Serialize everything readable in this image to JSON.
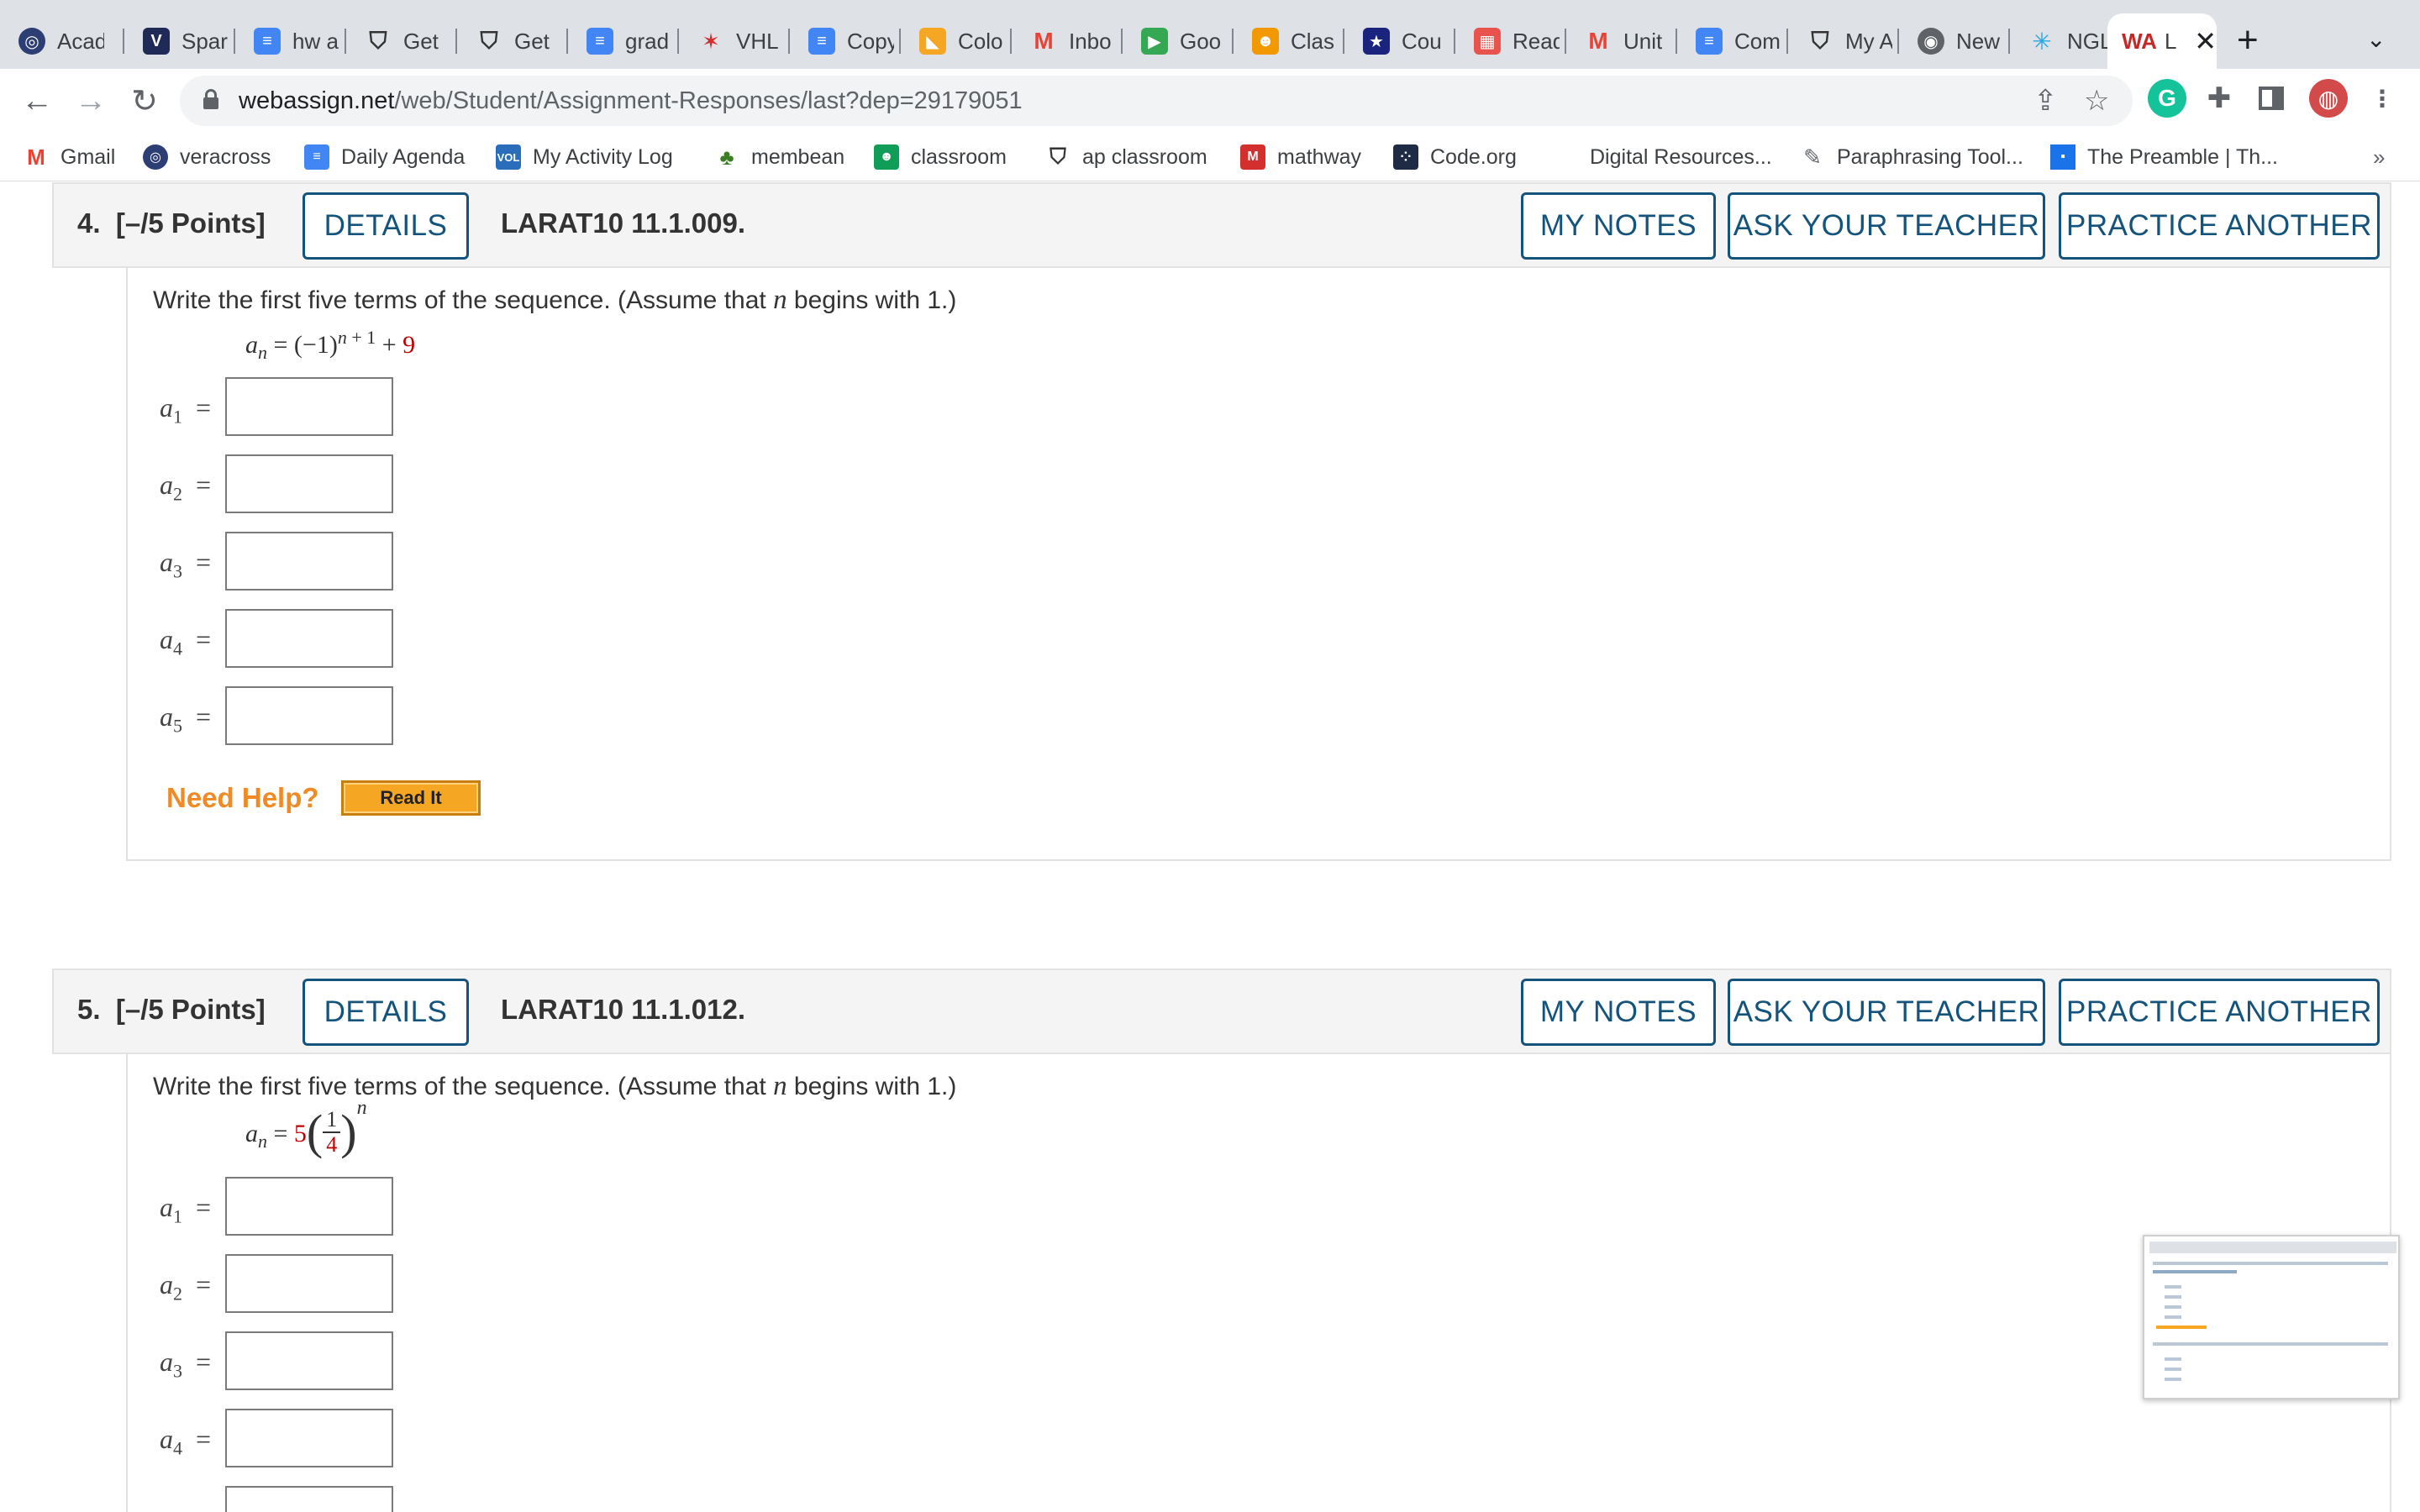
{
  "tabs": [
    {
      "title": "Acad",
      "icon": "circle-logo-icon",
      "color": "#2c3e73"
    },
    {
      "title": "Spar",
      "icon": "v-logo-icon",
      "color": "#1f2a57"
    },
    {
      "title": "hw a",
      "icon": "docs-icon",
      "color": "#4285f4"
    },
    {
      "title": "Get",
      "icon": "acorn-icon",
      "color": "#333333"
    },
    {
      "title": "Get",
      "icon": "acorn-icon",
      "color": "#333333"
    },
    {
      "title": "grad",
      "icon": "docs-icon",
      "color": "#4285f4"
    },
    {
      "title": "VHL",
      "icon": "vhl-icon",
      "color": "#d32f2f"
    },
    {
      "title": "Copy",
      "icon": "docs-icon",
      "color": "#4285f4"
    },
    {
      "title": "Colo",
      "icon": "color-icon",
      "color": "#f5a623"
    },
    {
      "title": "Inbo",
      "icon": "gmail-icon",
      "color": "#ea4335"
    },
    {
      "title": "Goo",
      "icon": "meet-icon",
      "color": "#34a853"
    },
    {
      "title": "Clas",
      "icon": "classroom-icon",
      "color": "#f29900"
    },
    {
      "title": "Cou",
      "icon": "star-badge-icon",
      "color": "#1a237e"
    },
    {
      "title": "Read",
      "icon": "calendar-grid-icon",
      "color": "#e8544d"
    },
    {
      "title": "Unit",
      "icon": "gmail-icon",
      "color": "#ea4335"
    },
    {
      "title": "Com",
      "icon": "docs-icon",
      "color": "#4285f4"
    },
    {
      "title": "My A",
      "icon": "acorn-icon",
      "color": "#333333"
    },
    {
      "title": "New",
      "icon": "chrome-icon",
      "color": "#5f6368"
    },
    {
      "title": "NGL",
      "icon": "sparkle-icon",
      "color": "#29a8e0"
    },
    {
      "title": "L",
      "icon": "webassign-icon",
      "color": "#c62828"
    }
  ],
  "browser": {
    "new_tab": "+",
    "tab_close": "✕",
    "tab_search": "⌄",
    "url_host": "webassign.net",
    "url_path": "/web/Student/Assignment-Responses/last?dep=29179051",
    "back": "←",
    "forward": "→",
    "reload": "↻"
  },
  "bookmarks": [
    {
      "label": "Gmail",
      "icon": "gmail-icon",
      "color": "#ea4335"
    },
    {
      "label": "veracross",
      "icon": "veracross-icon",
      "color": "#2c3e73"
    },
    {
      "label": "Daily Agenda",
      "icon": "docs-icon",
      "color": "#4285f4"
    },
    {
      "label": "My Activity Log",
      "icon": "vocab-icon",
      "color": "#2a6ebb"
    },
    {
      "label": "membean",
      "icon": "membean-icon",
      "color": "#3b7d23"
    },
    {
      "label": "classroom",
      "icon": "classroom-icon",
      "color": "#0f9d58"
    },
    {
      "label": "ap classroom",
      "icon": "acorn-icon",
      "color": "#333333"
    },
    {
      "label": "mathway",
      "icon": "mathway-icon",
      "color": "#d32f2f"
    },
    {
      "label": "Code.org",
      "icon": "code-org-icon",
      "color": "#1f2a44"
    },
    {
      "label": "Digital Resources...",
      "icon": "",
      "color": ""
    },
    {
      "label": "Paraphrasing Tool...",
      "icon": "feather-icon",
      "color": "#5f6368"
    },
    {
      "label": "The Preamble | Th...",
      "icon": "preamble-icon",
      "color": "#1a73e8"
    }
  ],
  "bookmarks_more": "»",
  "questions": [
    {
      "number": "4.",
      "points": "[–/5 Points]",
      "details": "DETAILS",
      "code": "LARAT10 11.1.009.",
      "my_notes": "MY NOTES",
      "ask_teacher": "ASK YOUR TEACHER",
      "practice": "PRACTICE ANOTHER",
      "prompt_before": "Write the first five terms of the sequence. (Assume that ",
      "prompt_var": "n",
      "prompt_after": " begins with 1.)",
      "terms": [
        "a1",
        "a2",
        "a3",
        "a4",
        "a5"
      ],
      "need_help": "Need Help?",
      "read_it": "Read It"
    },
    {
      "number": "5.",
      "points": "[–/5 Points]",
      "details": "DETAILS",
      "code": "LARAT10 11.1.012.",
      "my_notes": "MY NOTES",
      "ask_teacher": "ASK YOUR TEACHER",
      "practice": "PRACTICE ANOTHER",
      "prompt_before": "Write the first five terms of the sequence. (Assume that ",
      "prompt_var": "n",
      "prompt_after": " begins with 1.)",
      "terms": [
        "a1",
        "a2",
        "a3",
        "a4"
      ]
    }
  ],
  "colors": {
    "accent": "#14547c",
    "help": "#f08a24",
    "red_number": "#c00000"
  }
}
